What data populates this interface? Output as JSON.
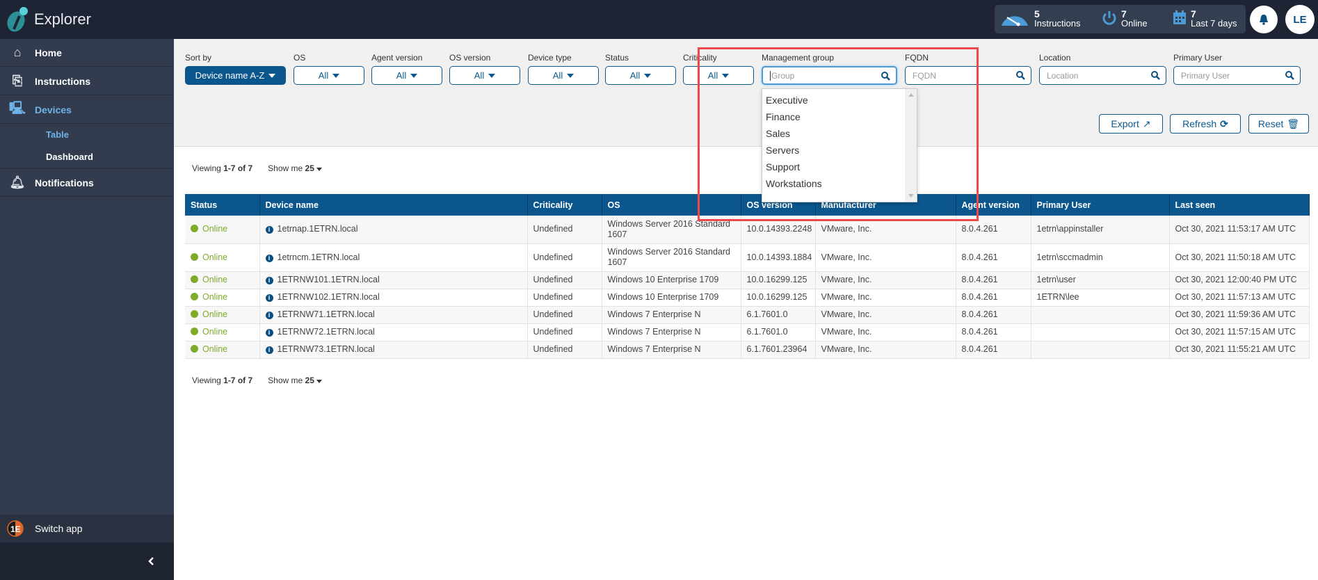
{
  "app": {
    "title": "Explorer"
  },
  "header": {
    "stats": [
      {
        "value": "5",
        "label": "Instructions",
        "icon": "gauge-icon"
      },
      {
        "value": "7",
        "label": "Online",
        "icon": "power-icon"
      },
      {
        "value": "7",
        "label": "Last 7 days",
        "icon": "calendar-icon"
      }
    ],
    "notifications_icon": "bell-icon",
    "avatar": "LE"
  },
  "sidebar": {
    "items": [
      {
        "label": "Home",
        "icon": "home-icon"
      },
      {
        "label": "Instructions",
        "icon": "instructions-icon"
      },
      {
        "label": "Devices",
        "icon": "devices-icon",
        "active": true
      },
      {
        "label": "Notifications",
        "icon": "bell-icon"
      }
    ],
    "sub_items": [
      {
        "label": "Table",
        "active": true
      },
      {
        "label": "Dashboard"
      }
    ],
    "switch_app": "Switch app",
    "collapse_icon": "chevron-left-icon"
  },
  "filters": {
    "sort_by": {
      "label": "Sort by",
      "value": "Device name A-Z"
    },
    "selects": [
      {
        "label": "OS",
        "value": "All"
      },
      {
        "label": "Agent version",
        "value": "All"
      },
      {
        "label": "OS version",
        "value": "All"
      },
      {
        "label": "Device type",
        "value": "All"
      },
      {
        "label": "Status",
        "value": "All"
      },
      {
        "label": "Criticality",
        "value": "All"
      }
    ],
    "inputs": [
      {
        "label": "Management group",
        "placeholder": "Group",
        "value": ""
      },
      {
        "label": "FQDN",
        "placeholder": "FQDN",
        "value": ""
      },
      {
        "label": "Location",
        "placeholder": "Location",
        "value": ""
      },
      {
        "label": "Primary User",
        "placeholder": "Primary User",
        "value": ""
      }
    ],
    "group_options": [
      "Executive",
      "Finance",
      "Sales",
      "Servers",
      "Support",
      "Workstations"
    ],
    "actions": {
      "export": "Export",
      "refresh": "Refresh",
      "reset": "Reset"
    }
  },
  "paging": {
    "viewing_prefix": "Viewing ",
    "range": "1-7 of 7",
    "show_me": "Show me ",
    "page_size": "25"
  },
  "table": {
    "columns": [
      "Status",
      "Device name",
      "Criticality",
      "OS",
      "OS version",
      "Manufacturer",
      "Agent version",
      "Primary User",
      "Last seen"
    ],
    "rows": [
      [
        "Online",
        "1etrnap.1ETRN.local",
        "Undefined",
        "Windows Server 2016 Standard 1607",
        "10.0.14393.2248",
        "VMware, Inc.",
        "8.0.4.261",
        "1etrn\\appinstaller",
        "Oct 30, 2021 11:53:17 AM UTC"
      ],
      [
        "Online",
        "1etrncm.1ETRN.local",
        "Undefined",
        "Windows Server 2016 Standard 1607",
        "10.0.14393.1884",
        "VMware, Inc.",
        "8.0.4.261",
        "1etrn\\sccmadmin",
        "Oct 30, 2021 11:50:18 AM UTC"
      ],
      [
        "Online",
        "1ETRNW101.1ETRN.local",
        "Undefined",
        "Windows 10 Enterprise 1709",
        "10.0.16299.125",
        "VMware, Inc.",
        "8.0.4.261",
        "1etrn\\user",
        "Oct 30, 2021 12:00:40 PM UTC"
      ],
      [
        "Online",
        "1ETRNW102.1ETRN.local",
        "Undefined",
        "Windows 10 Enterprise 1709",
        "10.0.16299.125",
        "VMware, Inc.",
        "8.0.4.261",
        "1ETRN\\lee",
        "Oct 30, 2021 11:57:13 AM UTC"
      ],
      [
        "Online",
        "1ETRNW71.1ETRN.local",
        "Undefined",
        "Windows 7 Enterprise N",
        "6.1.7601.0",
        "VMware, Inc.",
        "8.0.4.261",
        "",
        "Oct 30, 2021 11:59:36 AM UTC"
      ],
      [
        "Online",
        "1ETRNW72.1ETRN.local",
        "Undefined",
        "Windows 7 Enterprise N",
        "6.1.7601.0",
        "VMware, Inc.",
        "8.0.4.261",
        "",
        "Oct 30, 2021 11:57:15 AM UTC"
      ],
      [
        "Online",
        "1ETRNW73.1ETRN.local",
        "Undefined",
        "Windows 7 Enterprise N",
        "6.1.7601.23964",
        "VMware, Inc.",
        "8.0.4.261",
        "",
        "Oct 30, 2021 11:55:21 AM UTC"
      ]
    ]
  },
  "colors": {
    "brand": "#0b568d",
    "online": "#7fab2c",
    "highlight": "#ef4848",
    "sidebar": "#323c4e",
    "topbar": "#1e2433"
  }
}
